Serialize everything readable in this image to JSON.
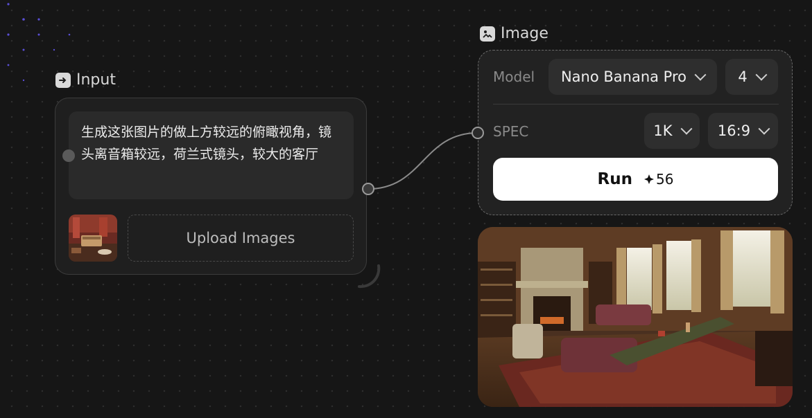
{
  "input_node": {
    "title": "Input",
    "prompt": "生成这张图片的做上方较远的俯瞰视角，镜头离音箱较远，荷兰式镜头，较大的客厅",
    "upload_label": "Upload Images"
  },
  "image_node": {
    "title": "Image",
    "model_label": "Model",
    "model_value": "Nano Banana Pro",
    "count_value": "4",
    "spec_label": "SPEC",
    "resolution_value": "1K",
    "aspect_value": "16:9",
    "run_label": "Run",
    "run_cost": "56"
  },
  "colors": {
    "background": "#161616",
    "node_bg": "#1f1f1f",
    "accent_dots": "#6b5cff",
    "run_button": "#ffffff"
  }
}
